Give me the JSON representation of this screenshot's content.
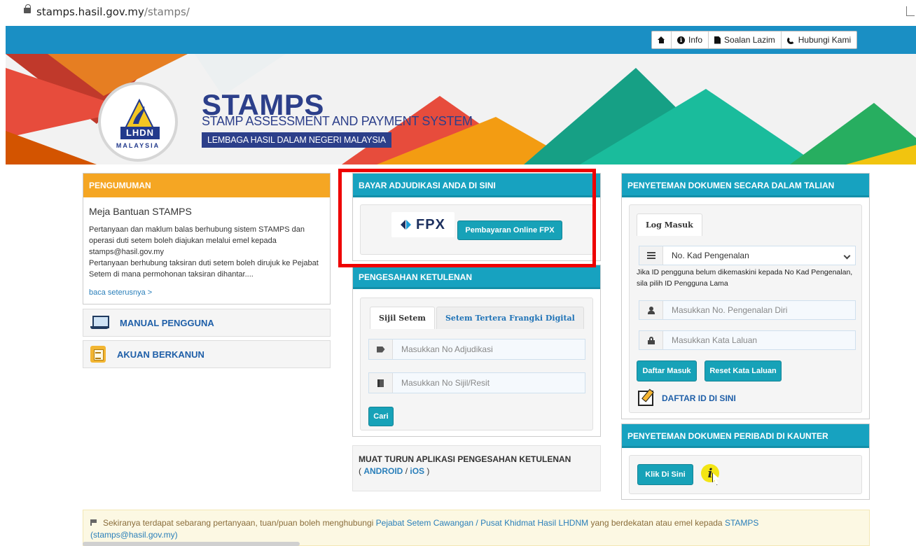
{
  "browser": {
    "url_host": "stamps.hasil.gov.my",
    "url_path": "/stamps/"
  },
  "topnav": {
    "info": "Info",
    "faq": "Soalan Lazim",
    "contact": "Hubungi Kami"
  },
  "banner": {
    "title": "STAMPS",
    "subtitle": "STAMP ASSESSMENT AND PAYMENT SYSTEM",
    "org": "LEMBAGA HASIL DALAM NEGERI MALAYSIA",
    "logo_text": "LHDN",
    "logo_sub": "MALAYSIA"
  },
  "announcement": {
    "header": "PENGUMUMAN",
    "title": "Meja Bantuan STAMPS",
    "body1": "Pertanyaan dan maklum balas berhubung sistem STAMPS dan operasi duti setem boleh diajukan melalui emel kepada stamps@hasil.gov.my",
    "body2": "Pertanyaan berhubung taksiran duti setem boleh dirujuk ke Pejabat Setem di mana permohonan taksiran dihantar....",
    "more": "baca seterusnya >"
  },
  "sidebar": {
    "manual": "MANUAL PENGGUNA",
    "akuan": "AKUAN BERKANUN"
  },
  "payment": {
    "header": "BAYAR ADJUDIKASI ANDA DI SINI",
    "fpx_logo": "FPX",
    "button": "Pembayaran Online FPX"
  },
  "verify": {
    "header": "PENGESAHAN KETULENAN",
    "tab1": "Sijil Setem",
    "tab2": "Setem Tertera Frangki Digital",
    "adjudikasi_placeholder": "Masukkan No Adjudikasi",
    "sijil_placeholder": "Masukkan No Sijil/Resit",
    "search_button": "Cari"
  },
  "app": {
    "title": "MUAT TURUN APLIKASI PENGESAHAN KETULENAN",
    "open": "(",
    "android": "ANDROID",
    "sep": "/",
    "ios": "iOS",
    "close": ")"
  },
  "login": {
    "header": "PENYETEMAN DOKUMEN SECARA DALAM TALIAN",
    "tab": "Log Masuk",
    "id_type": "No. Kad Pengenalan",
    "hint": "Jika ID pengguna belum dikemaskini kepada No Kad Pengenalan, sila pilih ID Pengguna Lama",
    "id_placeholder": "Masukkan No. Pengenalan Diri",
    "password_placeholder": "Masukkan Kata Laluan",
    "login_button": "Daftar Masuk",
    "reset_button": "Reset Kata Laluan",
    "register": "DAFTAR ID DI SINI"
  },
  "counter": {
    "header": "PENYETEMAN DOKUMEN PERIBADI DI KAUNTER",
    "button": "Klik Di Sini"
  },
  "notice": {
    "text1": "Sekiranya terdapat sebarang pertanyaan, tuan/puan boleh menghubungi",
    "link1": "Pejabat Setem Cawangan / Pusat Khidmat Hasil LHDNM",
    "text2": "yang berdekatan atau emel kepada",
    "link2": "STAMPS",
    "link3": "(stamps@hasil.gov.my)"
  }
}
